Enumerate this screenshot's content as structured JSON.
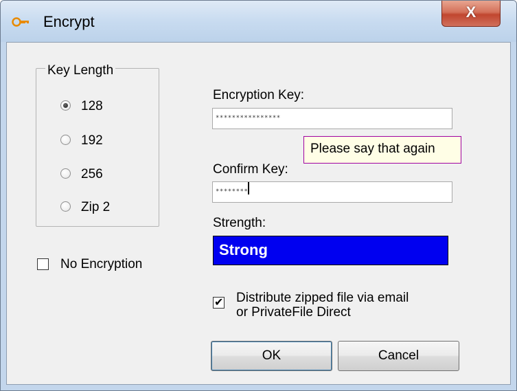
{
  "window": {
    "title": "Encrypt",
    "close_label": "X",
    "icon": "key-icon"
  },
  "key_length": {
    "group_label": "Key Length",
    "options": [
      {
        "label": "128",
        "selected": true
      },
      {
        "label": "192",
        "selected": false
      },
      {
        "label": "256",
        "selected": false
      },
      {
        "label": "Zip 2",
        "selected": false
      }
    ]
  },
  "no_encryption": {
    "label": "No Encryption",
    "checked": false
  },
  "encryption_key": {
    "label": "Encryption Key:",
    "value": "****************"
  },
  "tooltip": {
    "text": "Please say that again"
  },
  "confirm_key": {
    "label": "Confirm Key:",
    "value": "********"
  },
  "strength": {
    "label": "Strength:",
    "value": "Strong",
    "color": "#0000f0"
  },
  "distribute": {
    "label_line1": "Distribute zipped file via email",
    "label_line2": "or PrivateFile Direct",
    "checked": true
  },
  "buttons": {
    "ok": "OK",
    "cancel": "Cancel"
  }
}
